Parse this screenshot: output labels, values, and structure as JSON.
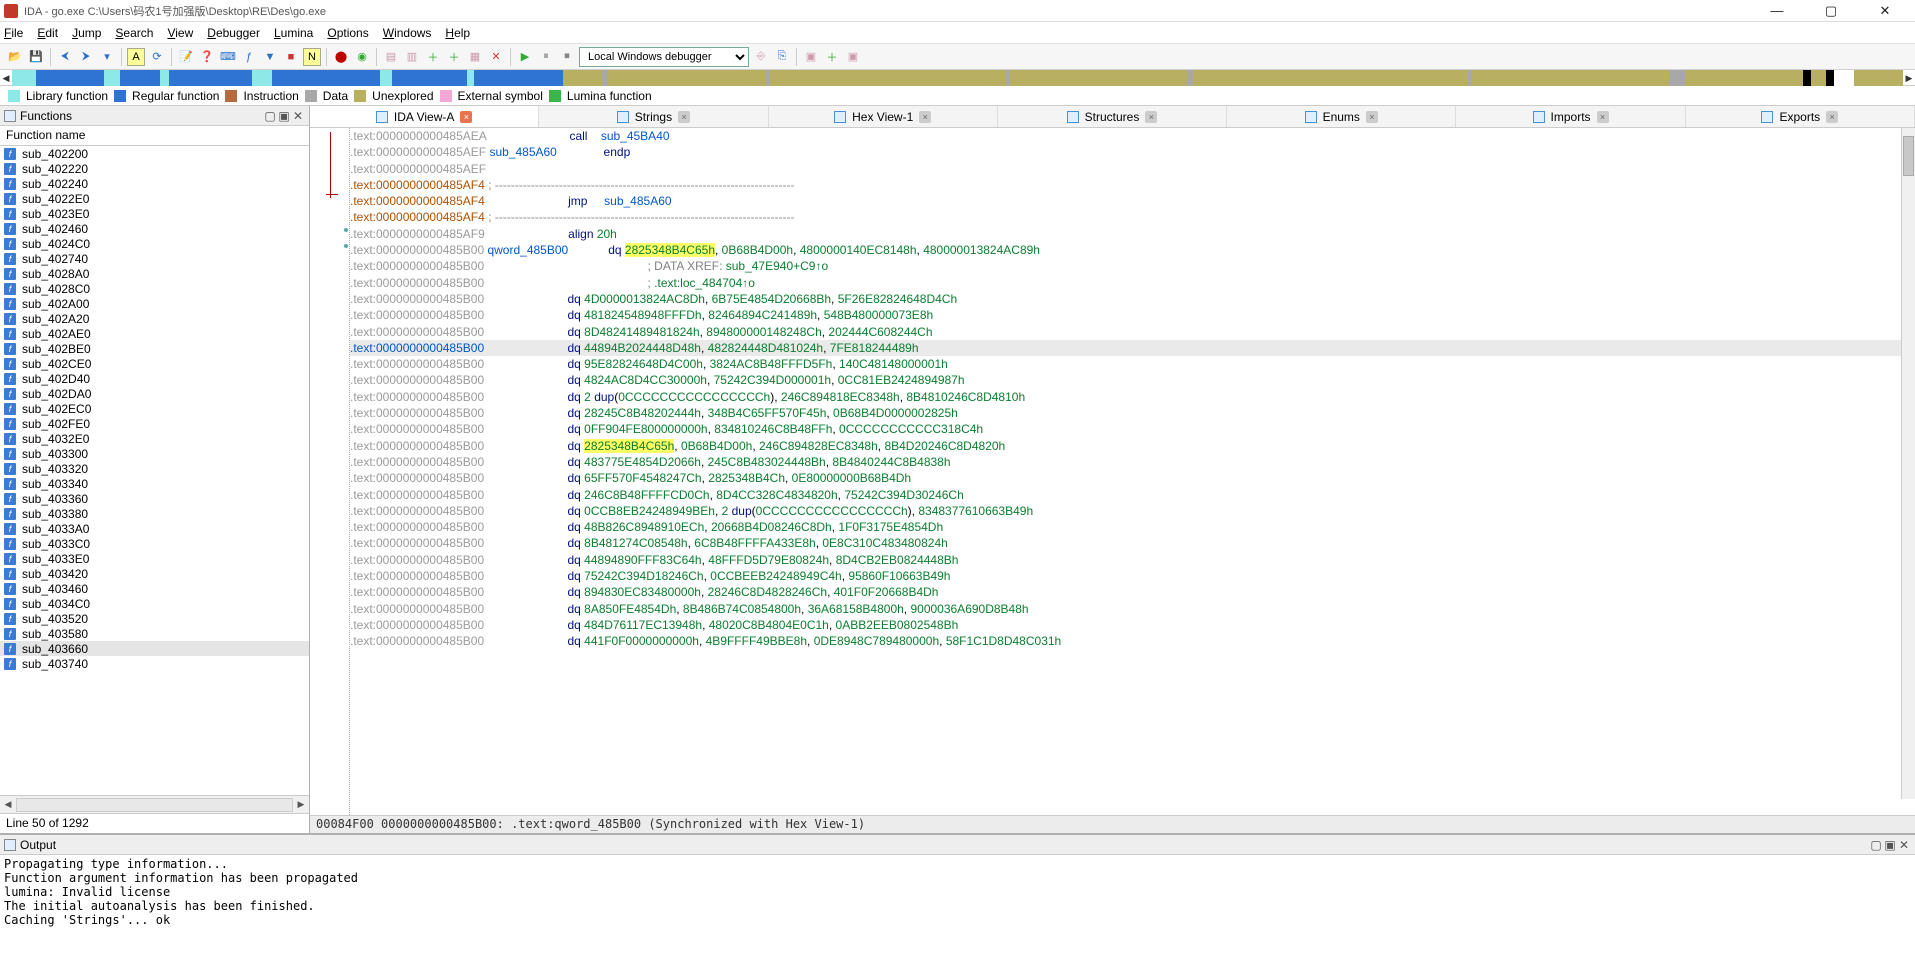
{
  "title": "IDA - go.exe C:\\Users\\码农1号加强版\\Desktop\\RE\\Des\\go.exe",
  "menus": [
    "File",
    "Edit",
    "Jump",
    "Search",
    "View",
    "Debugger",
    "Lumina",
    "Options",
    "Windows",
    "Help"
  ],
  "debugger_selected": "Local Windows debugger",
  "legend": [
    {
      "c": "#8fe8e8",
      "t": "Library function"
    },
    {
      "c": "#2f74d0",
      "t": "Regular function"
    },
    {
      "c": "#b36b3f",
      "t": "Instruction"
    },
    {
      "c": "#a8a8a8",
      "t": "Data"
    },
    {
      "c": "#b8b060",
      "t": "Unexplored"
    },
    {
      "c": "#f5a7d6",
      "t": "External symbol"
    },
    {
      "c": "#39b54a",
      "t": "Lumina function"
    }
  ],
  "nav_segments": [
    {
      "c": "#8fe8e8",
      "w": 1.2
    },
    {
      "c": "#2f74d0",
      "w": 3.5
    },
    {
      "c": "#8fe8e8",
      "w": 0.8
    },
    {
      "c": "#2f74d0",
      "w": 2.0
    },
    {
      "c": "#8fe8e8",
      "w": 0.5
    },
    {
      "c": "#2f74d0",
      "w": 4.2
    },
    {
      "c": "#8fe8e8",
      "w": 1.0
    },
    {
      "c": "#2f74d0",
      "w": 5.5
    },
    {
      "c": "#8fe8e8",
      "w": 0.6
    },
    {
      "c": "#2f74d0",
      "w": 3.8
    },
    {
      "c": "#8fe8e8",
      "w": 0.4
    },
    {
      "c": "#2f74d0",
      "w": 4.5
    },
    {
      "c": "#b8b060",
      "w": 2.0
    },
    {
      "c": "#a8a8a8",
      "w": 0.3
    },
    {
      "c": "#b8b060",
      "w": 8.0
    },
    {
      "c": "#a8a8a8",
      "w": 0.2
    },
    {
      "c": "#b8b060",
      "w": 12.0
    },
    {
      "c": "#a8a8a8",
      "w": 0.2
    },
    {
      "c": "#b8b060",
      "w": 9.0
    },
    {
      "c": "#a8a8a8",
      "w": 0.3
    },
    {
      "c": "#b8b060",
      "w": 14.0
    },
    {
      "c": "#a8a8a8",
      "w": 0.2
    },
    {
      "c": "#b8b060",
      "w": 10.0
    },
    {
      "c": "#a8a8a8",
      "w": 0.8
    },
    {
      "c": "#b8b060",
      "w": 6.0
    },
    {
      "c": "#000",
      "w": 0.4
    },
    {
      "c": "#b8b060",
      "w": 0.8
    },
    {
      "c": "#000",
      "w": 0.4
    },
    {
      "c": "#fff",
      "w": 1.0
    },
    {
      "c": "#b8b060",
      "w": 2.5
    }
  ],
  "functions_header": "Functions",
  "functions_col": "Function name",
  "functions": [
    "sub_402200",
    "sub_402220",
    "sub_402240",
    "sub_4022E0",
    "sub_4023E0",
    "sub_402460",
    "sub_4024C0",
    "sub_402740",
    "sub_4028A0",
    "sub_4028C0",
    "sub_402A00",
    "sub_402A20",
    "sub_402AE0",
    "sub_402BE0",
    "sub_402CE0",
    "sub_402D40",
    "sub_402DA0",
    "sub_402EC0",
    "sub_402FE0",
    "sub_4032E0",
    "sub_403300",
    "sub_403320",
    "sub_403340",
    "sub_403360",
    "sub_403380",
    "sub_4033A0",
    "sub_4033C0",
    "sub_4033E0",
    "sub_403420",
    "sub_403460",
    "sub_4034C0",
    "sub_403520",
    "sub_403580",
    "sub_403660",
    "sub_403740"
  ],
  "functions_selected": 33,
  "functions_status": "Line 50 of 1292",
  "tabs": [
    {
      "label": "IDA View-A",
      "active": true
    },
    {
      "label": "Strings",
      "active": false
    },
    {
      "label": "Hex View-1",
      "active": false
    },
    {
      "label": "Structures",
      "active": false
    },
    {
      "label": "Enums",
      "active": false
    },
    {
      "label": "Imports",
      "active": false
    },
    {
      "label": "Exports",
      "active": false
    }
  ],
  "disasm": [
    {
      "a": ".text:0000000000485AEA",
      "ac": "g",
      "body": [
        [
          "                        ",
          ""
        ],
        [
          "call    ",
          "ins"
        ],
        [
          "sub_45BA40",
          "sym"
        ]
      ]
    },
    {
      "a": ".text:0000000000485AEF",
      "ac": "g",
      "body": [
        [
          "sub_485A60",
          "sym"
        ],
        [
          "              ",
          ""
        ],
        [
          "endp",
          "ins"
        ]
      ]
    },
    {
      "a": ".text:0000000000485AEF",
      "ac": "g",
      "body": []
    },
    {
      "a": ".text:0000000000485AF4",
      "ac": "b",
      "body": [
        [
          "; ---------------------------------------------------------------------------",
          "dashline"
        ]
      ]
    },
    {
      "a": ".text:0000000000485AF4",
      "ac": "b",
      "body": [
        [
          "                        ",
          ""
        ],
        [
          "jmp     ",
          "ins"
        ],
        [
          "sub_485A60",
          "sym"
        ]
      ]
    },
    {
      "a": ".text:0000000000485AF4",
      "ac": "b",
      "body": [
        [
          "; ---------------------------------------------------------------------------",
          "dashline"
        ]
      ]
    },
    {
      "a": ".text:0000000000485AF9",
      "ac": "g",
      "body": [
        [
          "                        ",
          ""
        ],
        [
          "align ",
          "ins"
        ],
        [
          "20h",
          "num"
        ]
      ]
    },
    {
      "a": ".text:0000000000485B00",
      "ac": "g",
      "body": [
        [
          "qword_485B00",
          "sym"
        ],
        [
          "            ",
          ""
        ],
        [
          "dq ",
          "ins"
        ],
        [
          "2825348B4C65h",
          "num hiY"
        ],
        [
          ", ",
          ""
        ],
        [
          "0B68B4D00h",
          "num"
        ],
        [
          ", ",
          ""
        ],
        [
          "4800000140EC8148h",
          "num"
        ],
        [
          ", ",
          ""
        ],
        [
          "480000013824AC89h",
          "num"
        ]
      ]
    },
    {
      "a": ".text:0000000000485B00",
      "ac": "g",
      "body": [
        [
          "                                                ",
          ""
        ],
        [
          "; DATA XREF: ",
          "xref"
        ],
        [
          "sub_47E940+C9↑o",
          "xrefl"
        ]
      ]
    },
    {
      "a": ".text:0000000000485B00",
      "ac": "g",
      "body": [
        [
          "                                                ",
          ""
        ],
        [
          "; ",
          "xref"
        ],
        [
          ".text:loc_484704↑o",
          "xrefl"
        ]
      ]
    },
    {
      "a": ".text:0000000000485B00",
      "ac": "g",
      "body": [
        [
          "                        ",
          ""
        ],
        [
          "dq ",
          "ins"
        ],
        [
          "4D0000013824AC8Dh",
          "num"
        ],
        [
          ", ",
          ""
        ],
        [
          "6B75E4854D20668Bh",
          "num"
        ],
        [
          ", ",
          ""
        ],
        [
          "5F26E82824648D4Ch",
          "num"
        ]
      ]
    },
    {
      "a": ".text:0000000000485B00",
      "ac": "g",
      "body": [
        [
          "                        ",
          ""
        ],
        [
          "dq ",
          "ins"
        ],
        [
          "481824548948FFFDh",
          "num"
        ],
        [
          ", ",
          ""
        ],
        [
          "82464894C241489h",
          "num"
        ],
        [
          ", ",
          ""
        ],
        [
          "548B480000073E8h",
          "num"
        ]
      ]
    },
    {
      "a": ".text:0000000000485B00",
      "ac": "g",
      "body": [
        [
          "                        ",
          ""
        ],
        [
          "dq ",
          "ins"
        ],
        [
          "8D48241489481824h",
          "num"
        ],
        [
          ", ",
          ""
        ],
        [
          "894800000148248Ch",
          "num"
        ],
        [
          ", ",
          ""
        ],
        [
          "202444C608244Ch",
          "num"
        ]
      ]
    },
    {
      "a": ".text:0000000000485B00",
      "ac": "l",
      "hl": true,
      "body": [
        [
          "                        ",
          ""
        ],
        [
          "dq ",
          "ins"
        ],
        [
          "44894",
          "num"
        ],
        [
          "B2024448D48h",
          "num"
        ],
        [
          ", ",
          ""
        ],
        [
          "482824448D481024h",
          "num"
        ],
        [
          ", ",
          ""
        ],
        [
          "7FE818244489h",
          "num"
        ]
      ]
    },
    {
      "a": ".text:0000000000485B00",
      "ac": "g",
      "body": [
        [
          "                        ",
          ""
        ],
        [
          "dq ",
          "ins"
        ],
        [
          "95E82824648D4C00h",
          "num"
        ],
        [
          ", ",
          ""
        ],
        [
          "3824AC8B48FFFD5Fh",
          "num"
        ],
        [
          ", ",
          ""
        ],
        [
          "140C48148000001h",
          "num"
        ]
      ]
    },
    {
      "a": ".text:0000000000485B00",
      "ac": "g",
      "body": [
        [
          "                        ",
          ""
        ],
        [
          "dq ",
          "ins"
        ],
        [
          "4824AC8D4CC30000h",
          "num"
        ],
        [
          ", ",
          ""
        ],
        [
          "75242C394D000001h",
          "num"
        ],
        [
          ", ",
          ""
        ],
        [
          "0CC81EB2424894987h",
          "num"
        ]
      ]
    },
    {
      "a": ".text:0000000000485B00",
      "ac": "g",
      "body": [
        [
          "                        ",
          ""
        ],
        [
          "dq ",
          "ins"
        ],
        [
          "2 ",
          "num"
        ],
        [
          "dup",
          "ins"
        ],
        [
          "(",
          ""
        ],
        [
          "0CCCCCCCCCCCCCCCCh",
          "num"
        ],
        [
          "), ",
          ""
        ],
        [
          "246C894818EC8348h",
          "num"
        ],
        [
          ", ",
          ""
        ],
        [
          "8B4810246C8D4810h",
          "num"
        ]
      ]
    },
    {
      "a": ".text:0000000000485B00",
      "ac": "g",
      "body": [
        [
          "                        ",
          ""
        ],
        [
          "dq ",
          "ins"
        ],
        [
          "28245C8B48202444h",
          "num"
        ],
        [
          ", ",
          ""
        ],
        [
          "348B4C65FF570F45h",
          "num"
        ],
        [
          ", ",
          ""
        ],
        [
          "0B68B4D0000002825h",
          "num"
        ]
      ]
    },
    {
      "a": ".text:0000000000485B00",
      "ac": "g",
      "body": [
        [
          "                        ",
          ""
        ],
        [
          "dq ",
          "ins"
        ],
        [
          "0FF904FE800000000h",
          "num"
        ],
        [
          ", ",
          ""
        ],
        [
          "834810246C8B48FFh",
          "num"
        ],
        [
          ", ",
          ""
        ],
        [
          "0CCCCCCCCCCC318C4h",
          "num"
        ]
      ]
    },
    {
      "a": ".text:0000000000485B00",
      "ac": "g",
      "body": [
        [
          "                        ",
          ""
        ],
        [
          "dq ",
          "ins"
        ],
        [
          "2825348B4C65h",
          "num hiY"
        ],
        [
          ", ",
          ""
        ],
        [
          "0B68B4D00h",
          "num"
        ],
        [
          ", ",
          ""
        ],
        [
          "246C894828EC8348h",
          "num"
        ],
        [
          ", ",
          ""
        ],
        [
          "8B4D20246C8D4820h",
          "num"
        ]
      ]
    },
    {
      "a": ".text:0000000000485B00",
      "ac": "g",
      "body": [
        [
          "                        ",
          ""
        ],
        [
          "dq ",
          "ins"
        ],
        [
          "483775E4854D2066h",
          "num"
        ],
        [
          ", ",
          ""
        ],
        [
          "245C8B483024448Bh",
          "num"
        ],
        [
          ", ",
          ""
        ],
        [
          "8B4840244C8B4838h",
          "num"
        ]
      ]
    },
    {
      "a": ".text:0000000000485B00",
      "ac": "g",
      "body": [
        [
          "                        ",
          ""
        ],
        [
          "dq ",
          "ins"
        ],
        [
          "65FF570F4548247Ch",
          "num"
        ],
        [
          ", ",
          ""
        ],
        [
          "2825348B4Ch",
          "num"
        ],
        [
          ", ",
          ""
        ],
        [
          "0E80000000B68B4Dh",
          "num"
        ]
      ]
    },
    {
      "a": ".text:0000000000485B00",
      "ac": "g",
      "body": [
        [
          "                        ",
          ""
        ],
        [
          "dq ",
          "ins"
        ],
        [
          "246C8B48FFFFCD0Ch",
          "num"
        ],
        [
          ", ",
          ""
        ],
        [
          "8D4CC328C4834820h",
          "num"
        ],
        [
          ", ",
          ""
        ],
        [
          "75242C394D30246Ch",
          "num"
        ]
      ]
    },
    {
      "a": ".text:0000000000485B00",
      "ac": "g",
      "body": [
        [
          "                        ",
          ""
        ],
        [
          "dq ",
          "ins"
        ],
        [
          "0CCB8EB24248949BEh",
          "num"
        ],
        [
          ", ",
          ""
        ],
        [
          "2 ",
          "num"
        ],
        [
          "dup",
          "ins"
        ],
        [
          "(",
          ""
        ],
        [
          "0CCCCCCCCCCCCCCCCh",
          "num"
        ],
        [
          "), ",
          ""
        ],
        [
          "8348377610663B49h",
          "num"
        ]
      ]
    },
    {
      "a": ".text:0000000000485B00",
      "ac": "g",
      "body": [
        [
          "                        ",
          ""
        ],
        [
          "dq ",
          "ins"
        ],
        [
          "48B826C8948910ECh",
          "num"
        ],
        [
          ", ",
          ""
        ],
        [
          "20668B4D08246C8Dh",
          "num"
        ],
        [
          ", ",
          ""
        ],
        [
          "1F0F3175E4854Dh",
          "num"
        ]
      ]
    },
    {
      "a": ".text:0000000000485B00",
      "ac": "g",
      "body": [
        [
          "                        ",
          ""
        ],
        [
          "dq ",
          "ins"
        ],
        [
          "8B481274C08548h",
          "num"
        ],
        [
          ", ",
          ""
        ],
        [
          "6C8B48FFFFA433E8h",
          "num"
        ],
        [
          ", ",
          ""
        ],
        [
          "0E8C310C483480824h",
          "num"
        ]
      ]
    },
    {
      "a": ".text:0000000000485B00",
      "ac": "g",
      "body": [
        [
          "                        ",
          ""
        ],
        [
          "dq ",
          "ins"
        ],
        [
          "44894890FFF83C64h",
          "num"
        ],
        [
          ", ",
          ""
        ],
        [
          "48FFFD5D79E80824h",
          "num"
        ],
        [
          ", ",
          ""
        ],
        [
          "8D4CB2EB0824448Bh",
          "num"
        ]
      ]
    },
    {
      "a": ".text:0000000000485B00",
      "ac": "g",
      "body": [
        [
          "                        ",
          ""
        ],
        [
          "dq ",
          "ins"
        ],
        [
          "75242C394D18246Ch",
          "num"
        ],
        [
          ", ",
          ""
        ],
        [
          "0CCBEEB24248949C4h",
          "num"
        ],
        [
          ", ",
          ""
        ],
        [
          "95860F10663B49h",
          "num"
        ]
      ]
    },
    {
      "a": ".text:0000000000485B00",
      "ac": "g",
      "body": [
        [
          "                        ",
          ""
        ],
        [
          "dq ",
          "ins"
        ],
        [
          "894830EC83480000h",
          "num"
        ],
        [
          ", ",
          ""
        ],
        [
          "28246C8D4828246Ch",
          "num"
        ],
        [
          ", ",
          ""
        ],
        [
          "401F0F20668B4Dh",
          "num"
        ]
      ]
    },
    {
      "a": ".text:0000000000485B00",
      "ac": "g",
      "body": [
        [
          "                        ",
          ""
        ],
        [
          "dq ",
          "ins"
        ],
        [
          "8A850FE4854Dh",
          "num"
        ],
        [
          ", ",
          ""
        ],
        [
          "8B486B74C0854800h",
          "num"
        ],
        [
          ", ",
          ""
        ],
        [
          "36A68158B4800h",
          "num"
        ],
        [
          ", ",
          ""
        ],
        [
          "9000036A690D8B48h",
          "num"
        ]
      ]
    },
    {
      "a": ".text:0000000000485B00",
      "ac": "g",
      "body": [
        [
          "                        ",
          ""
        ],
        [
          "dq ",
          "ins"
        ],
        [
          "484D76117EC13948h",
          "num"
        ],
        [
          ", ",
          ""
        ],
        [
          "48020C8B4804E0C1h",
          "num"
        ],
        [
          ", ",
          ""
        ],
        [
          "0ABB2EEB0802548Bh",
          "num"
        ]
      ]
    },
    {
      "a": ".text:0000000000485B00",
      "ac": "g",
      "body": [
        [
          "                        ",
          ""
        ],
        [
          "dq ",
          "ins"
        ],
        [
          "441F0F0000000000h",
          "num"
        ],
        [
          ", ",
          ""
        ],
        [
          "4B9FFFF49BBE8h",
          "num"
        ],
        [
          ", ",
          ""
        ],
        [
          "0DE8948C789480000h",
          "num"
        ],
        [
          ", ",
          ""
        ],
        [
          "58F1C1D8D48C031h",
          "num"
        ]
      ]
    }
  ],
  "sync_status": "00084F00 0000000000485B00: .text:qword_485B00 (Synchronized with Hex View-1)",
  "output_header": "Output",
  "output_lines": [
    "Propagating type information...",
    "Function argument information has been propagated",
    "lumina: Invalid license",
    "The initial autoanalysis has been finished.",
    "Caching 'Strings'... ok",
    ""
  ]
}
